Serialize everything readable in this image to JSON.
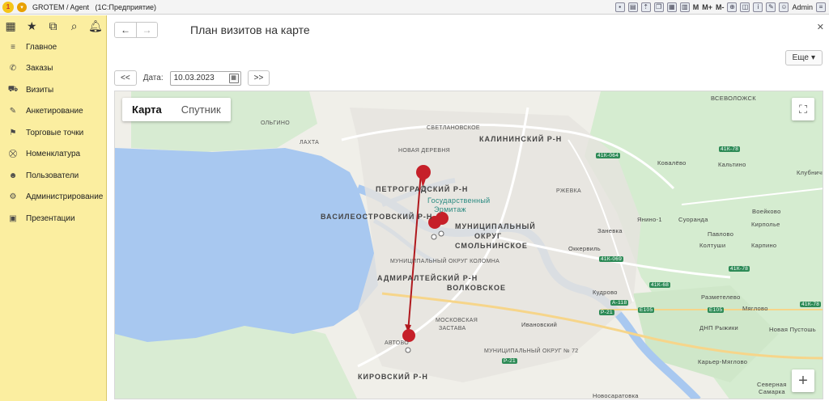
{
  "titlebar": {
    "app_title": "GROTEM / Agent",
    "platform": "(1С:Предприятие)",
    "m_labels": [
      "M",
      "M+",
      "M-"
    ],
    "user": "Admin"
  },
  "sidebar": {
    "items": [
      {
        "label": "Главное",
        "icon": "menu-lines-icon"
      },
      {
        "label": "Заказы",
        "icon": "phone-icon"
      },
      {
        "label": "Визиты",
        "icon": "car-icon"
      },
      {
        "label": "Анкетирование",
        "icon": "edit-icon"
      },
      {
        "label": "Торговые точки",
        "icon": "flag-icon"
      },
      {
        "label": "Номенклатура",
        "icon": "cart-icon"
      },
      {
        "label": "Пользователи",
        "icon": "users-icon"
      },
      {
        "label": "Администрирование",
        "icon": "gear-icon"
      },
      {
        "label": "Презентации",
        "icon": "image-icon"
      }
    ]
  },
  "page": {
    "title": "План визитов на карте",
    "more_label": "Еще",
    "prev_label": "<<",
    "next_label": ">>",
    "date_label": "Дата:",
    "date_value": "10.03.2023"
  },
  "map": {
    "type_map": "Карта",
    "type_satellite": "Спутник",
    "labels": {
      "vsevolozhsk": "ВСЕВОЛОЖСК",
      "olgino": "ОЛЬГИНО",
      "svetlanovskoe": "СВЕТЛАНОВСКОЕ",
      "kalininsky": "КАЛИНИНСКИЙ Р-Н",
      "lakhta": "ЛАХТА",
      "novaya_derevnya": "НОВАЯ ДЕРЕВНЯ",
      "petrogradsky": "ПЕТРОГРАДСКИЙ Р-Н",
      "hermitage_1": "Государственный",
      "hermitage_2": "Эрмитаж",
      "rzhevka": "РЖЕВКА",
      "kovalevo": "Ковалёво",
      "kaltino": "Кальтино",
      "klubnichny": "Клубничн",
      "vasileostrovsky": "ВАСИЛЕОСТРОВСКИЙ Р-Н",
      "smolninskoe_1": "МУНИЦИПАЛЬНЫЙ",
      "smolninskoe_2": "ОКРУГ",
      "smolninskoe_3": "СМОЛЬНИНСКОЕ",
      "zanevka": "Заневка",
      "yanino": "Янино-1",
      "suoranda": "Суоранда",
      "voeykovo": "Воейково",
      "kirpolye": "Кирполье",
      "pavlovo": "Павлово",
      "koltushi": "Колтуши",
      "karpino": "Карпино",
      "okkervil": "Оккервиль",
      "kolomna": "МУНИЦИПАЛЬНЫЙ ОКРУГ КОЛОМНА",
      "admiralteysky": "АДМИРАЛТЕЙСКИЙ Р-Н",
      "volkovskoe": "ВОЛКОВСКОЕ",
      "kudrovo": "Кудрово",
      "razmetelevo": "Разметелево",
      "myaglovo": "Мяглово",
      "dnp_ryzhiki": "ДНП Рыжики",
      "novaya_pustosh": "Новая Пустошь",
      "moskovskaya_1": "МОСКОВСКАЯ",
      "moskovskaya_2": "ЗАСТАВА",
      "ivanovsky": "Ивановский",
      "avtovo": "АВТОВО",
      "okrug72": "МУНИЦИПАЛЬНЫЙ ОКРУГ № 72",
      "karier": "Карьер-Мяглово",
      "kirovsky": "КИРОВСКИЙ Р-Н",
      "severnaya_1": "Северная",
      "severnaya_2": "Самарка",
      "novosaratovka": "Новосаратовка"
    },
    "roads": [
      "41К-064",
      "41К-78",
      "41К-069",
      "41К-78",
      "41К-68",
      "А-118",
      "E105",
      "E105",
      "Р-21",
      "Р-21",
      "41К-78"
    ]
  }
}
